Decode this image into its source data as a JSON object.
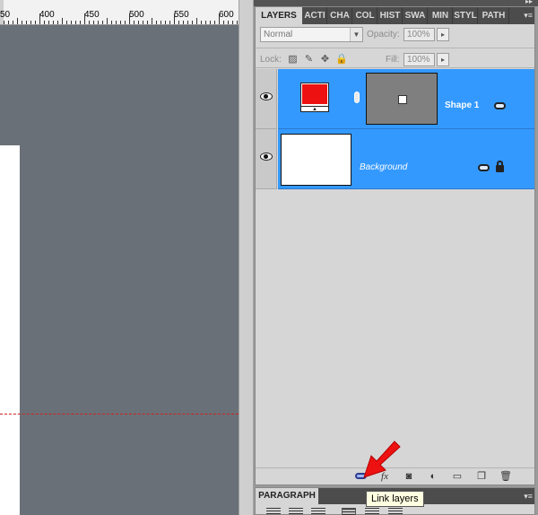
{
  "ruler": {
    "labels": [
      "50",
      "400",
      "450",
      "500",
      "550",
      "600"
    ]
  },
  "layers_panel": {
    "tabs": [
      "LAYERS",
      "ACTI",
      "CHA",
      "COL",
      "HIST",
      "SWA",
      "MIN",
      "STYL",
      "PATH"
    ],
    "active_tab": "LAYERS",
    "blend_mode": "Normal",
    "opacity_label": "Opacity:",
    "opacity_value": "100%",
    "lock_label": "Lock:",
    "fill_label": "Fill:",
    "fill_value": "100%",
    "layers": [
      {
        "name": "Shape 1",
        "selected": true,
        "color": "#ee1111"
      },
      {
        "name": "Background",
        "selected": true
      }
    ]
  },
  "paragraph_panel": {
    "title": "PARAGRAPH"
  },
  "tooltip": "Link layers",
  "colors": {
    "accent": "#3399ff",
    "arrow": "#ee1111",
    "canvas_bg": "#6a7077"
  }
}
